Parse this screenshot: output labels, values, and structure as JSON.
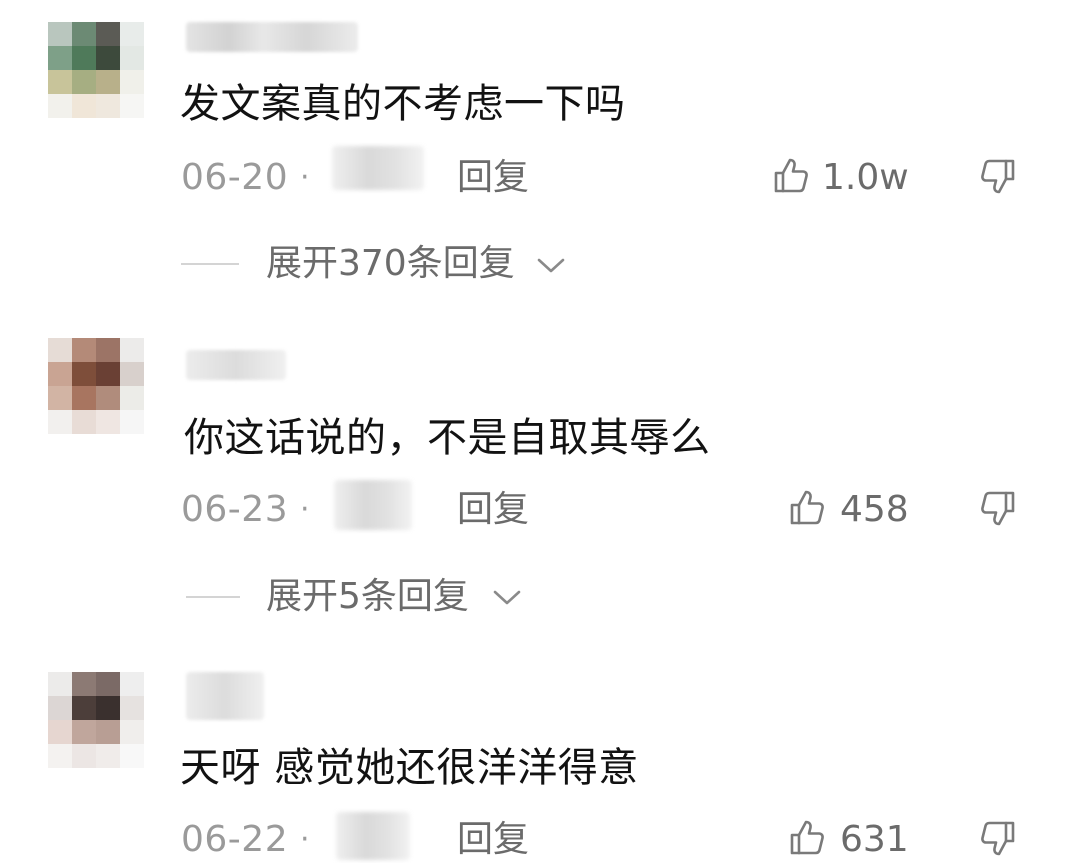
{
  "comments": [
    {
      "text": "发文案真的不考虑一下吗",
      "date": "06-20",
      "separator": "·",
      "reply_label": "回复",
      "likes": "1.0w",
      "expand_label": "展开370条回复",
      "avatar_colors": [
        "#b9c6be",
        "#6c8a74",
        "#5b5b55",
        "#e8ecea",
        "#7ea088",
        "#4f7a5a",
        "#3d4a3c",
        "#e3e8e4",
        "#c8c49a",
        "#a6ae82",
        "#b8b08a",
        "#f0f0ea",
        "#f2f1ec",
        "#f0e6d8",
        "#efe8de",
        "#f6f6f4"
      ]
    },
    {
      "text": "你这话说的，不是自取其辱么",
      "date": "06-23",
      "separator": "·",
      "reply_label": "回复",
      "likes": "458",
      "expand_label": "展开5条回复",
      "avatar_colors": [
        "#e6dcd6",
        "#b48a78",
        "#9c7466",
        "#ecebea",
        "#c9a493",
        "#7e4e3a",
        "#6a4034",
        "#d8d0cc",
        "#d2b4a4",
        "#a87560",
        "#b08c7c",
        "#ecece8",
        "#f2f0ee",
        "#e8dcd6",
        "#efe6e2",
        "#f6f6f6"
      ]
    },
    {
      "text": "天呀 感觉她还很洋洋得意",
      "date": "06-22",
      "separator": "·",
      "reply_label": "回复",
      "likes": "631",
      "avatar_colors": [
        "#ecebea",
        "#8c7a74",
        "#7b6a66",
        "#eeeeee",
        "#dcd6d4",
        "#4c3e3a",
        "#3a302e",
        "#e6e2e0",
        "#e6d6d0",
        "#c0a69c",
        "#b89e94",
        "#f0eeec",
        "#f4f2f0",
        "#ece6e4",
        "#f0ecea",
        "#f8f8f8"
      ]
    }
  ]
}
